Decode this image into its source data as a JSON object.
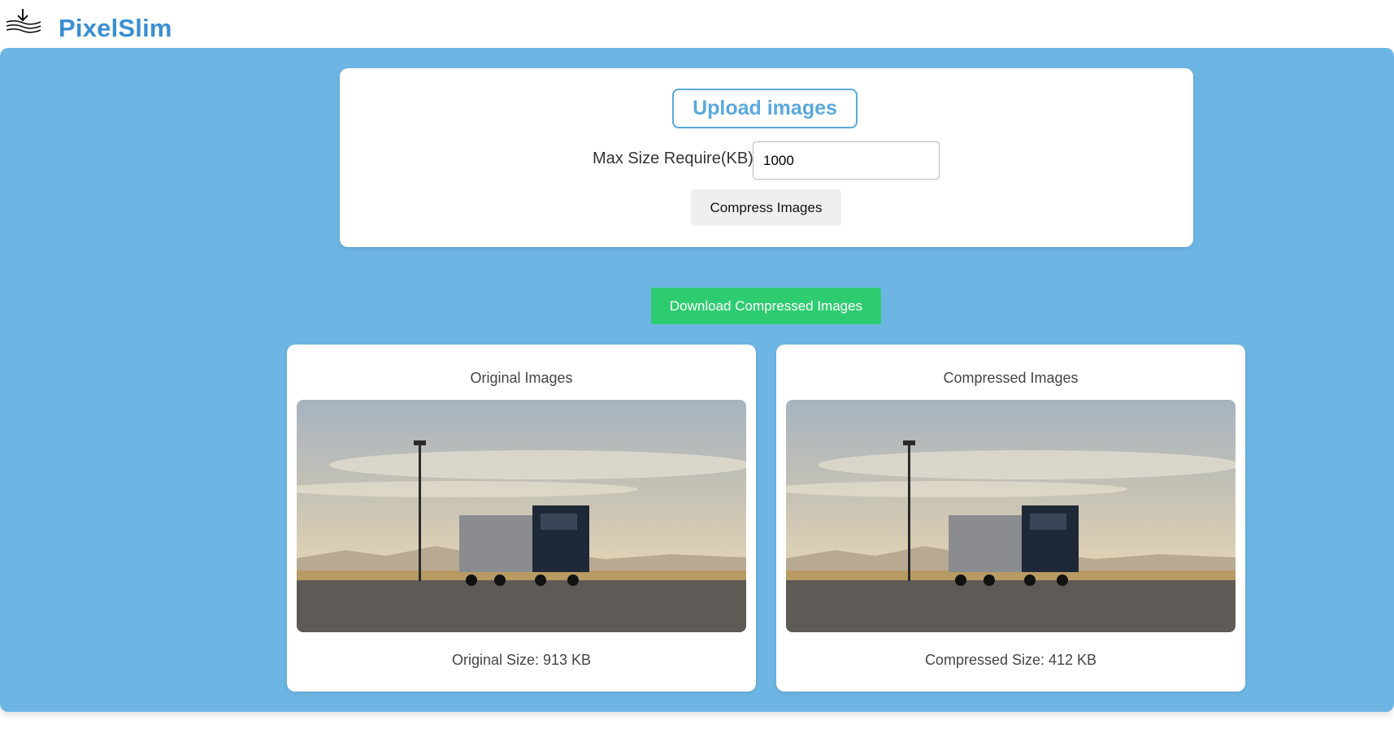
{
  "brand": {
    "name": "PixelSlim",
    "icon": "compress-download-icon",
    "color": "#3a8fd4"
  },
  "upload": {
    "button_label": "Upload images",
    "size_label": "Max Size Require(KB):",
    "size_value": "1000",
    "compress_label": "Compress Images"
  },
  "download": {
    "label": "Download Compressed Images",
    "color": "#2ecc71"
  },
  "original": {
    "title": "Original Images",
    "size_text": "Original Size: 913 KB"
  },
  "compressed": {
    "title": "Compressed Images",
    "size_text": "Compressed Size: 412 KB"
  },
  "colors": {
    "background": "#6db6e3",
    "accent": "#5aa9dd"
  }
}
